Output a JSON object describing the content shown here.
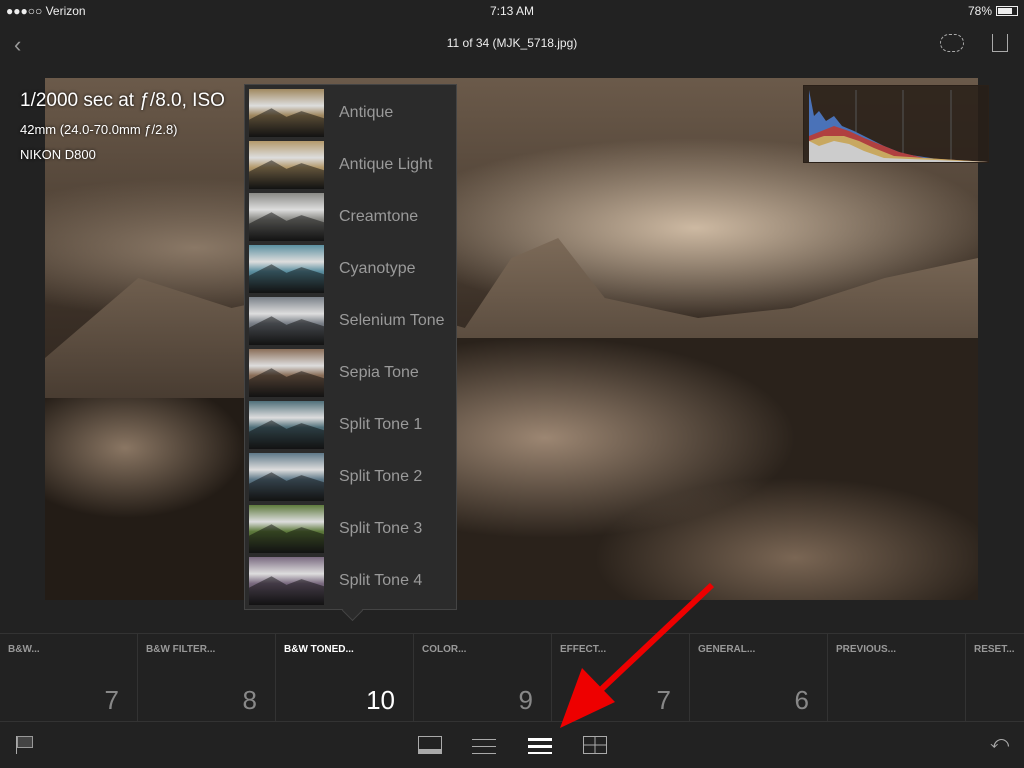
{
  "status": {
    "carrier": "●●●○○ Verizon",
    "time": "7:13 AM",
    "battery": "78%"
  },
  "nav": {
    "title": "11 of 34 (MJK_5718.jpg)"
  },
  "photo_info": {
    "exposure": "1/2000 sec at ƒ/8.0, ISO",
    "lens": "42mm (24.0-70.0mm ƒ/2.8)",
    "camera": "NIKON D800"
  },
  "presets": [
    {
      "label": "Antique",
      "tint": "#a08860"
    },
    {
      "label": "Antique Light",
      "tint": "#b49a6c"
    },
    {
      "label": "Creamtone",
      "tint": "#8a8a86"
    },
    {
      "label": "Cyanotype",
      "tint": "#5b8fa0"
    },
    {
      "label": "Selenium Tone",
      "tint": "#7a8088"
    },
    {
      "label": "Sepia Tone",
      "tint": "#8a6e58"
    },
    {
      "label": "Split Tone 1",
      "tint": "#50707a"
    },
    {
      "label": "Split Tone 2",
      "tint": "#5e7888"
    },
    {
      "label": "Split Tone 3",
      "tint": "#5e7a3c"
    },
    {
      "label": "Split Tone 4",
      "tint": "#7a6a80"
    }
  ],
  "groups": [
    {
      "label": "B&W...",
      "count": "7"
    },
    {
      "label": "B&W FILTER...",
      "count": "8"
    },
    {
      "label": "B&W TONED...",
      "count": "10",
      "selected": true
    },
    {
      "label": "COLOR...",
      "count": "9"
    },
    {
      "label": "EFFECT...",
      "count": "7"
    },
    {
      "label": "GENERAL...",
      "count": "6"
    },
    {
      "label": "PREVIOUS...",
      "count": ""
    },
    {
      "label": "RESET...",
      "count": ""
    }
  ]
}
